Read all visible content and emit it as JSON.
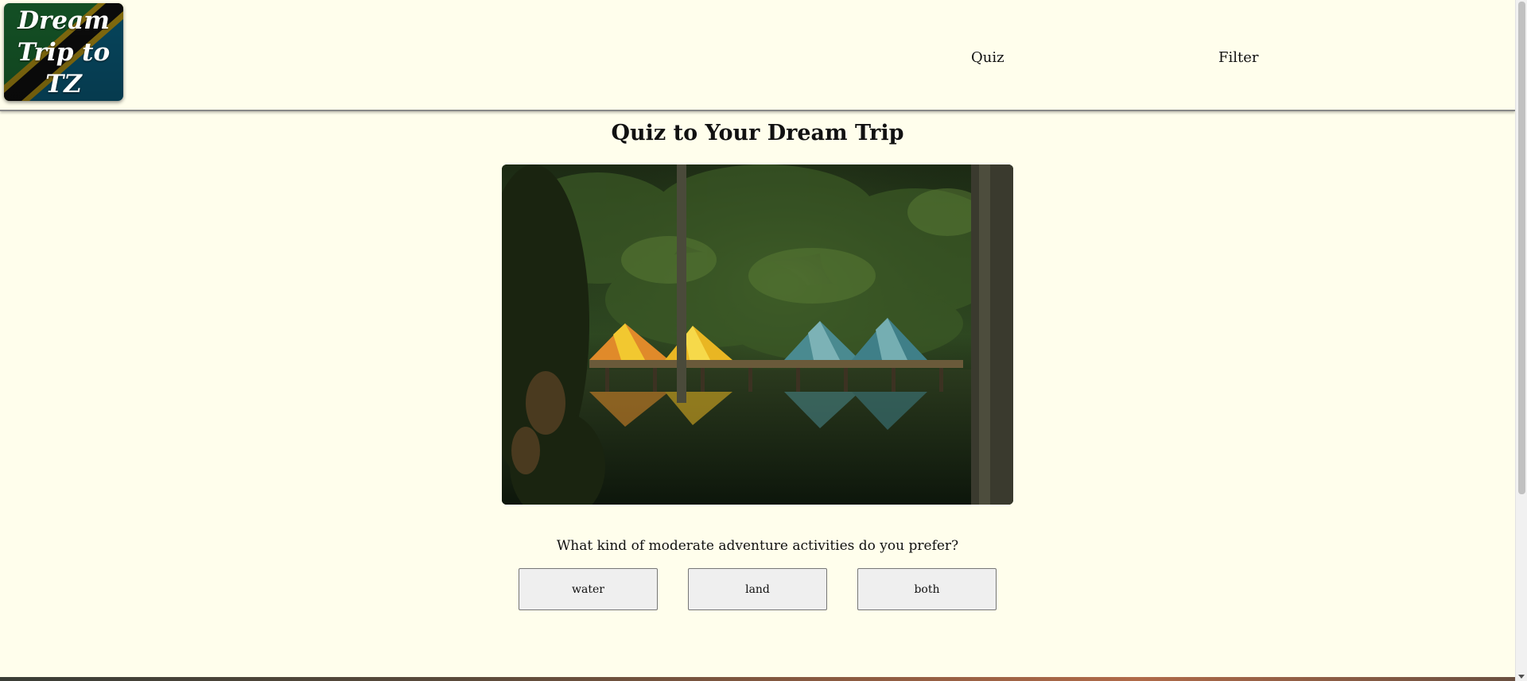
{
  "header": {
    "logo_text": "Dream Trip to TZ",
    "nav": [
      {
        "label": "Quiz"
      },
      {
        "label": "Filter"
      }
    ]
  },
  "main": {
    "title": "Quiz to Your Dream Trip",
    "image_alt": "tents by a lake in the forest",
    "question": "What kind of moderate adventure activities do you prefer?",
    "answers": [
      {
        "label": "water"
      },
      {
        "label": "land"
      },
      {
        "label": "both"
      }
    ]
  },
  "colors": {
    "background": "#fffeec",
    "button_bg": "#efefef",
    "flag_green": "#1eb53a",
    "flag_blue": "#00a3dd",
    "flag_yellow": "#fcd116",
    "flag_black": "#000000"
  }
}
